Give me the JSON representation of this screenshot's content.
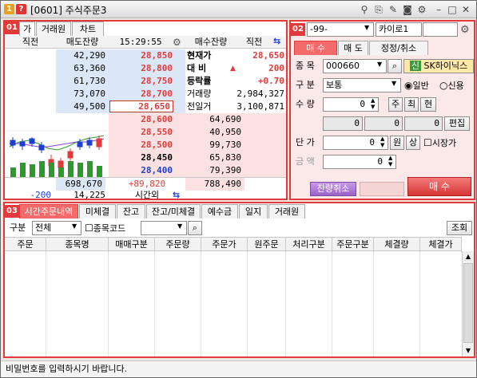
{
  "window": {
    "title": "[0601] 주식주문3",
    "badge1": "1",
    "badge2": "?"
  },
  "orderbook": {
    "badge": "01",
    "tabs": [
      "가",
      "거래원",
      "차트"
    ],
    "header": {
      "prev_left": "직전",
      "sell_qty": "매도잔량",
      "time": "15:29:55",
      "buy_qty": "매수잔량",
      "prev_right": "직전"
    },
    "asks": [
      {
        "qty": "42,290",
        "price": "28,850"
      },
      {
        "qty": "63,360",
        "price": "28,800"
      },
      {
        "qty": "61,730",
        "price": "28,750"
      },
      {
        "qty": "73,070",
        "price": "28,700"
      },
      {
        "qty": "49,500",
        "price": "28,650"
      }
    ],
    "bids": [
      {
        "price": "28,600",
        "qty": "64,690"
      },
      {
        "price": "28,550",
        "qty": "40,950"
      },
      {
        "price": "28,500",
        "qty": "99,730"
      },
      {
        "price": "28,450",
        "qty": "65,830"
      },
      {
        "price": "28,400",
        "qty": "79,390"
      }
    ],
    "info": [
      {
        "label": "현재가",
        "value": "28,650"
      },
      {
        "label": "대  비",
        "arrow": "▲",
        "value": "200"
      },
      {
        "label": "등락률",
        "value": "+0.70"
      },
      {
        "label": "거래량",
        "value": "2,984,327"
      },
      {
        "label": "전일거",
        "value": "3,100,871"
      }
    ],
    "totals": {
      "sell_total": "698,670",
      "diff": "+89,820",
      "buy_total": "788,490"
    },
    "after": {
      "change": "-200",
      "qty": "14,225",
      "label": "시간외"
    }
  },
  "order": {
    "badge": "02",
    "account": "-99-",
    "account_name": "카이로1",
    "tabs": [
      "매  수",
      "매  도",
      "정정/취소"
    ],
    "stock_label": "종  목",
    "stock_code": "000660",
    "stock_new": "신",
    "stock_name": "SK하이닉스",
    "type_label": "구  분",
    "type_value": "보통",
    "radio_general": "일반",
    "radio_credit": "신용",
    "qty_label": "수  량",
    "qty_value": "0",
    "qty_btns": [
      "주",
      "최",
      "현"
    ],
    "qty2": [
      "0",
      "0",
      "0"
    ],
    "edit_btn": "편집",
    "price_label": "단  가",
    "price_value": "0",
    "price_btns": [
      "원",
      "상"
    ],
    "market_label": "시장가",
    "amount_label": "금  액",
    "amount_value": "0",
    "cancel_rest": "잔량취소",
    "submit": "매  수"
  },
  "history": {
    "badge": "03",
    "tabs": [
      "시간주문내역",
      "미체결",
      "잔고",
      "잔고/미체결",
      "예수금",
      "일지",
      "거래원"
    ],
    "filter_label": "구분",
    "filter_value": "전체",
    "code_label": "종목코드",
    "query": "조회",
    "columns": [
      "주문",
      "종목명",
      "매매구분",
      "주문량",
      "주문가",
      "원주문",
      "처리구분",
      "주문구분",
      "체결량",
      "체결가"
    ]
  },
  "status": {
    "message": "비밀번호를 입력하시기 바랍니다."
  },
  "chart_colors": {
    "up": "#e23a3a",
    "down": "#1e3fd4",
    "volume": "#2e9a2e"
  }
}
